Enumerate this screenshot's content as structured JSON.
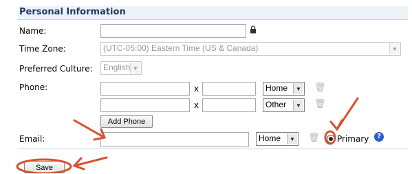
{
  "section_title": "Personal Information",
  "labels": {
    "name": "Name:",
    "time_zone": "Time Zone:",
    "culture": "Preferred Culture:",
    "phone": "Phone:",
    "email": "Email:"
  },
  "time_zone_value": "(UTC-05:00) Eastern Time (US & Canada)",
  "culture_value": "English",
  "phones": [
    {
      "type": "Home",
      "x_label": "x"
    },
    {
      "type": "Other",
      "x_label": "x"
    }
  ],
  "add_phone_label": "Add Phone",
  "email": {
    "type": "Home",
    "primary_label": "Primary"
  },
  "save_label": "Save",
  "help_glyph": "?",
  "colors": {
    "annotation": "#d9502f",
    "header_bg": "#eef3fa",
    "title": "#1f3b63"
  }
}
